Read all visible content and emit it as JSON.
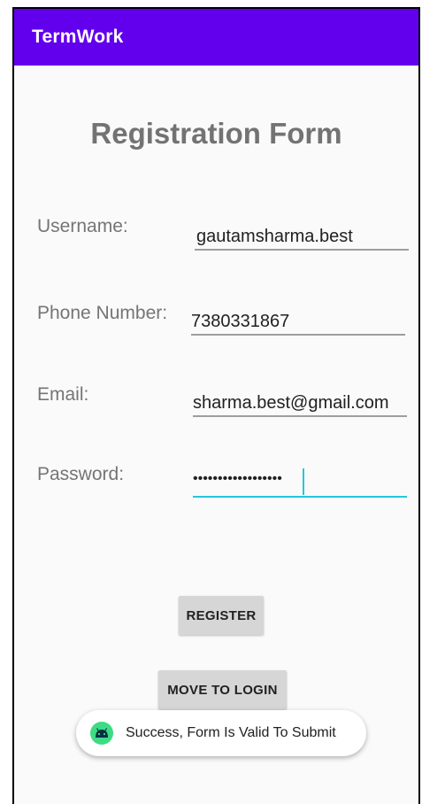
{
  "app_bar": {
    "title": "TermWork",
    "color": "#6200ee"
  },
  "form": {
    "title": "Registration Form",
    "fields": [
      {
        "label": "Username:",
        "value": "gautamsharma.best"
      },
      {
        "label": "Phone Number:",
        "value": "7380331867"
      },
      {
        "label": "Email:",
        "value": "sharma.best@gmail.com"
      },
      {
        "label": "Password:",
        "value": "••••••••••••••••••",
        "focused": true
      }
    ]
  },
  "buttons": {
    "register": "REGISTER",
    "move_to_login": "MOVE TO LOGIN"
  },
  "toast": {
    "icon": "android-icon",
    "message": "Success, Form Is Valid To Submit"
  },
  "colors": {
    "accent": "#26c6da",
    "toast_icon": "#3ddc84"
  }
}
